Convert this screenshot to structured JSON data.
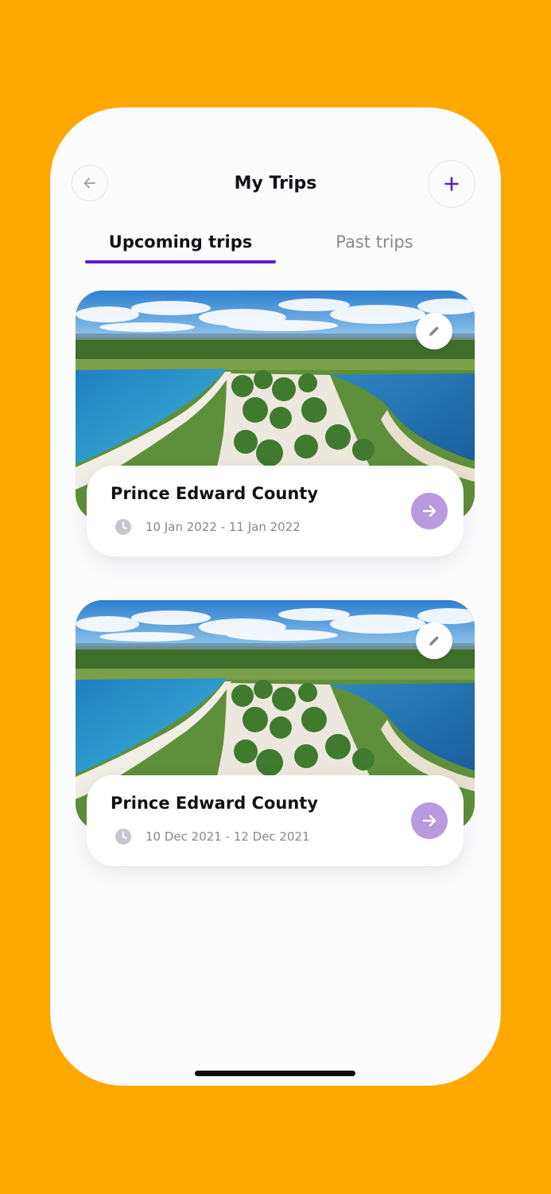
{
  "header": {
    "title": "My Trips",
    "back_icon": "arrow-left-icon",
    "add_icon": "plus-icon"
  },
  "tabs": [
    {
      "label": "Upcoming trips",
      "active": true
    },
    {
      "label": "Past trips",
      "active": false
    }
  ],
  "trips": [
    {
      "name": "Prince Edward County",
      "dates": "10 Jan 2022 - 11 Jan 2022",
      "image": "aerial beach peninsula photo"
    },
    {
      "name": "Prince Edward County",
      "dates": "10 Dec 2021 - 12 Dec 2021",
      "image": "aerial beach peninsula photo"
    }
  ],
  "colors": {
    "background": "#FFA800",
    "accent": "#5A22C8",
    "go_button": "#B79BDD",
    "text_primary": "#141019",
    "text_secondary": "#8A8690"
  }
}
